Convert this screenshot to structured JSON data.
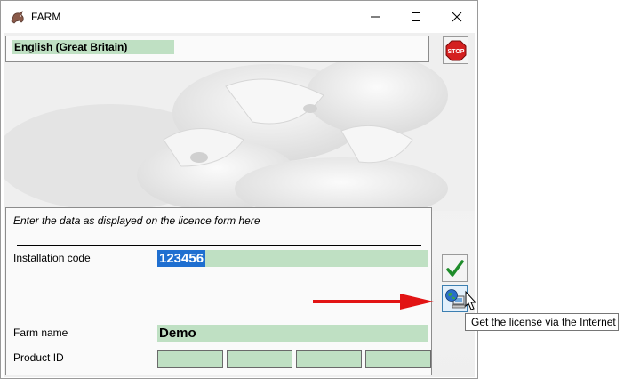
{
  "window": {
    "title": "FARM"
  },
  "language": {
    "value": "English (Great Britain)"
  },
  "form": {
    "hint": "Enter the data as displayed on the licence form here",
    "installation_code_label": "Installation code",
    "installation_code_value": "123456",
    "farm_name_label": "Farm name",
    "farm_name_value": "Demo",
    "product_id_label": "Product ID",
    "product_id_fields": [
      "",
      "",
      "",
      ""
    ]
  },
  "buttons": {
    "stop_label": "STOP",
    "confirm_icon": "checkmark-icon",
    "internet_icon": "globe-computer-icon"
  },
  "tooltip": {
    "text": "Get the license via the Internet"
  },
  "colors": {
    "field_green": "#bfe0c3",
    "selection_blue": "#1f6fd0",
    "arrow_red": "#e21414",
    "stop_red": "#d42020"
  }
}
